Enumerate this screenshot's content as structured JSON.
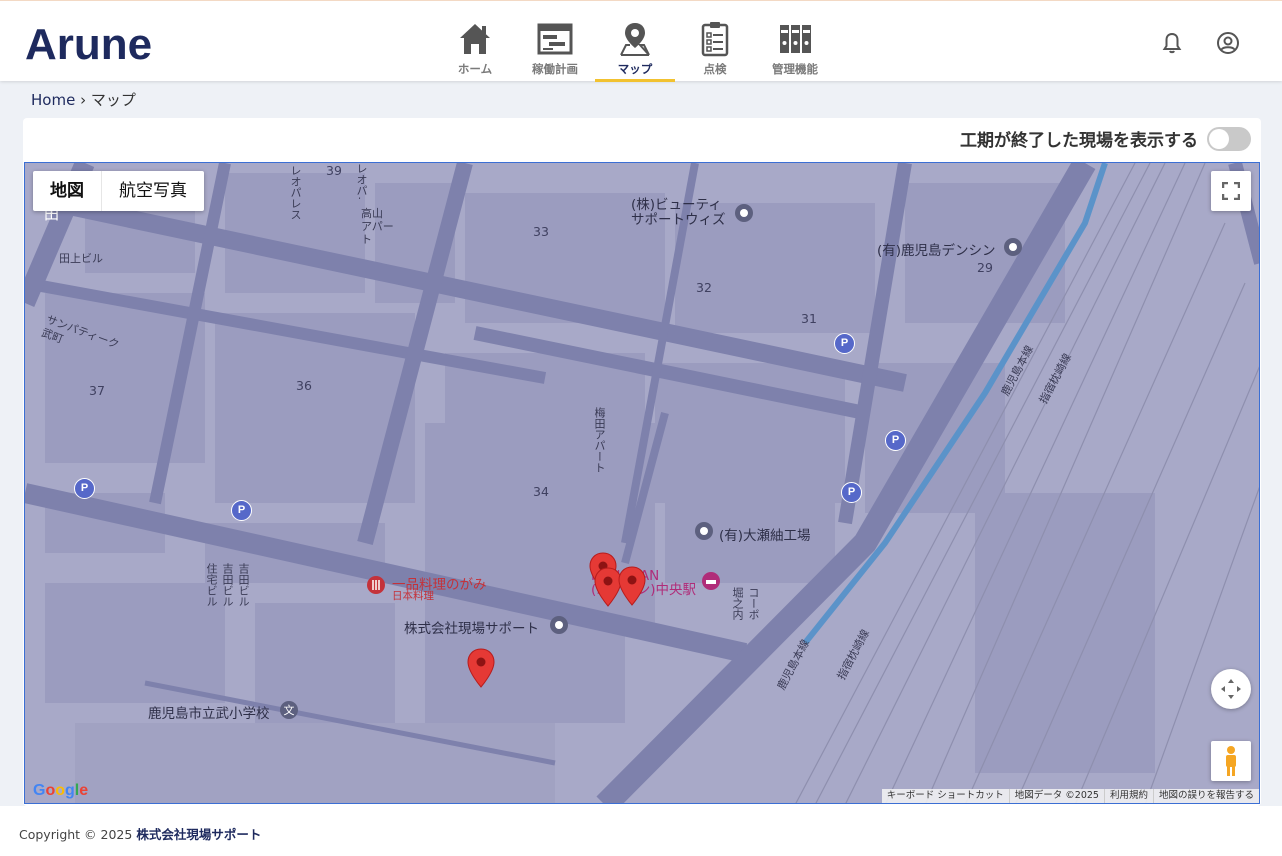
{
  "app": {
    "logo_text": "Arune"
  },
  "nav": {
    "items": [
      {
        "label": "ホーム",
        "icon": "home-icon"
      },
      {
        "label": "稼働計画",
        "icon": "schedule-icon"
      },
      {
        "label": "マップ",
        "icon": "map-pin-icon",
        "active": true
      },
      {
        "label": "点検",
        "icon": "clipboard-icon"
      },
      {
        "label": "管理機能",
        "icon": "binders-icon"
      }
    ],
    "accent_color": "#f2c230"
  },
  "header": {
    "notifications_icon": "bell-icon",
    "account_icon": "user-icon"
  },
  "breadcrumb": {
    "home": "Home",
    "separator": "›",
    "current": "マップ"
  },
  "toggle": {
    "label": "工期が終了した現場を表示する",
    "checked": false
  },
  "map": {
    "type_controls": {
      "map": "地図",
      "satellite": "航空写真"
    },
    "labels": {
      "n39": "39",
      "leo_palace_1": "レオパレス\nプロヴァン",
      "leo_palace_2": "レオパレス\nベル",
      "takayama": "高山\nアパート",
      "yanagida": "柳田",
      "taue": "田上ビル",
      "sunpatique": "サンパティーク\n武町",
      "n33": "33",
      "beauty": "(株)ビューティ\nサポートウィズ",
      "densin": "(有)鹿児島デンシン",
      "n29": "29",
      "n32": "32",
      "n31": "31",
      "n36": "36",
      "n37": "37",
      "umeda": "梅田アパート",
      "n34": "34",
      "ohse": "(有)大瀬紬工場",
      "ippin": "一品料理のがみ",
      "ippin_sub": "日本料理",
      "hanadan": "HANADAN\n(ハナダン)中央駅",
      "yoshida": "吉田ビル\n吉田ビル\n住宅ビル",
      "corpo": "コーポ\n堀之内",
      "genba": "株式会社現場サポート",
      "school": "鹿児島市立武小学校",
      "kagoshima_line_1": "鹿児島本線",
      "shuku_line_1": "指宿枕崎線",
      "kagoshima_line_2": "鹿児島本線",
      "shuku_line_2": "指宿枕崎線",
      "parking": "P"
    },
    "pins": [
      {
        "name": "site-pin-1"
      },
      {
        "name": "site-pin-2"
      },
      {
        "name": "site-pin-3"
      },
      {
        "name": "site-pin-4"
      }
    ],
    "pin_color": "#e53935",
    "attribution": [
      "キーボード ショートカット",
      "地図データ ©2025",
      "利用規約",
      "地図の誤りを報告する"
    ],
    "google_logo": "Google",
    "controls": [
      "fullscreen-icon",
      "recenter-icon",
      "pegman-icon"
    ]
  },
  "footer": {
    "copyright": "Copyright © 2025",
    "company": "株式会社現場サポート"
  }
}
